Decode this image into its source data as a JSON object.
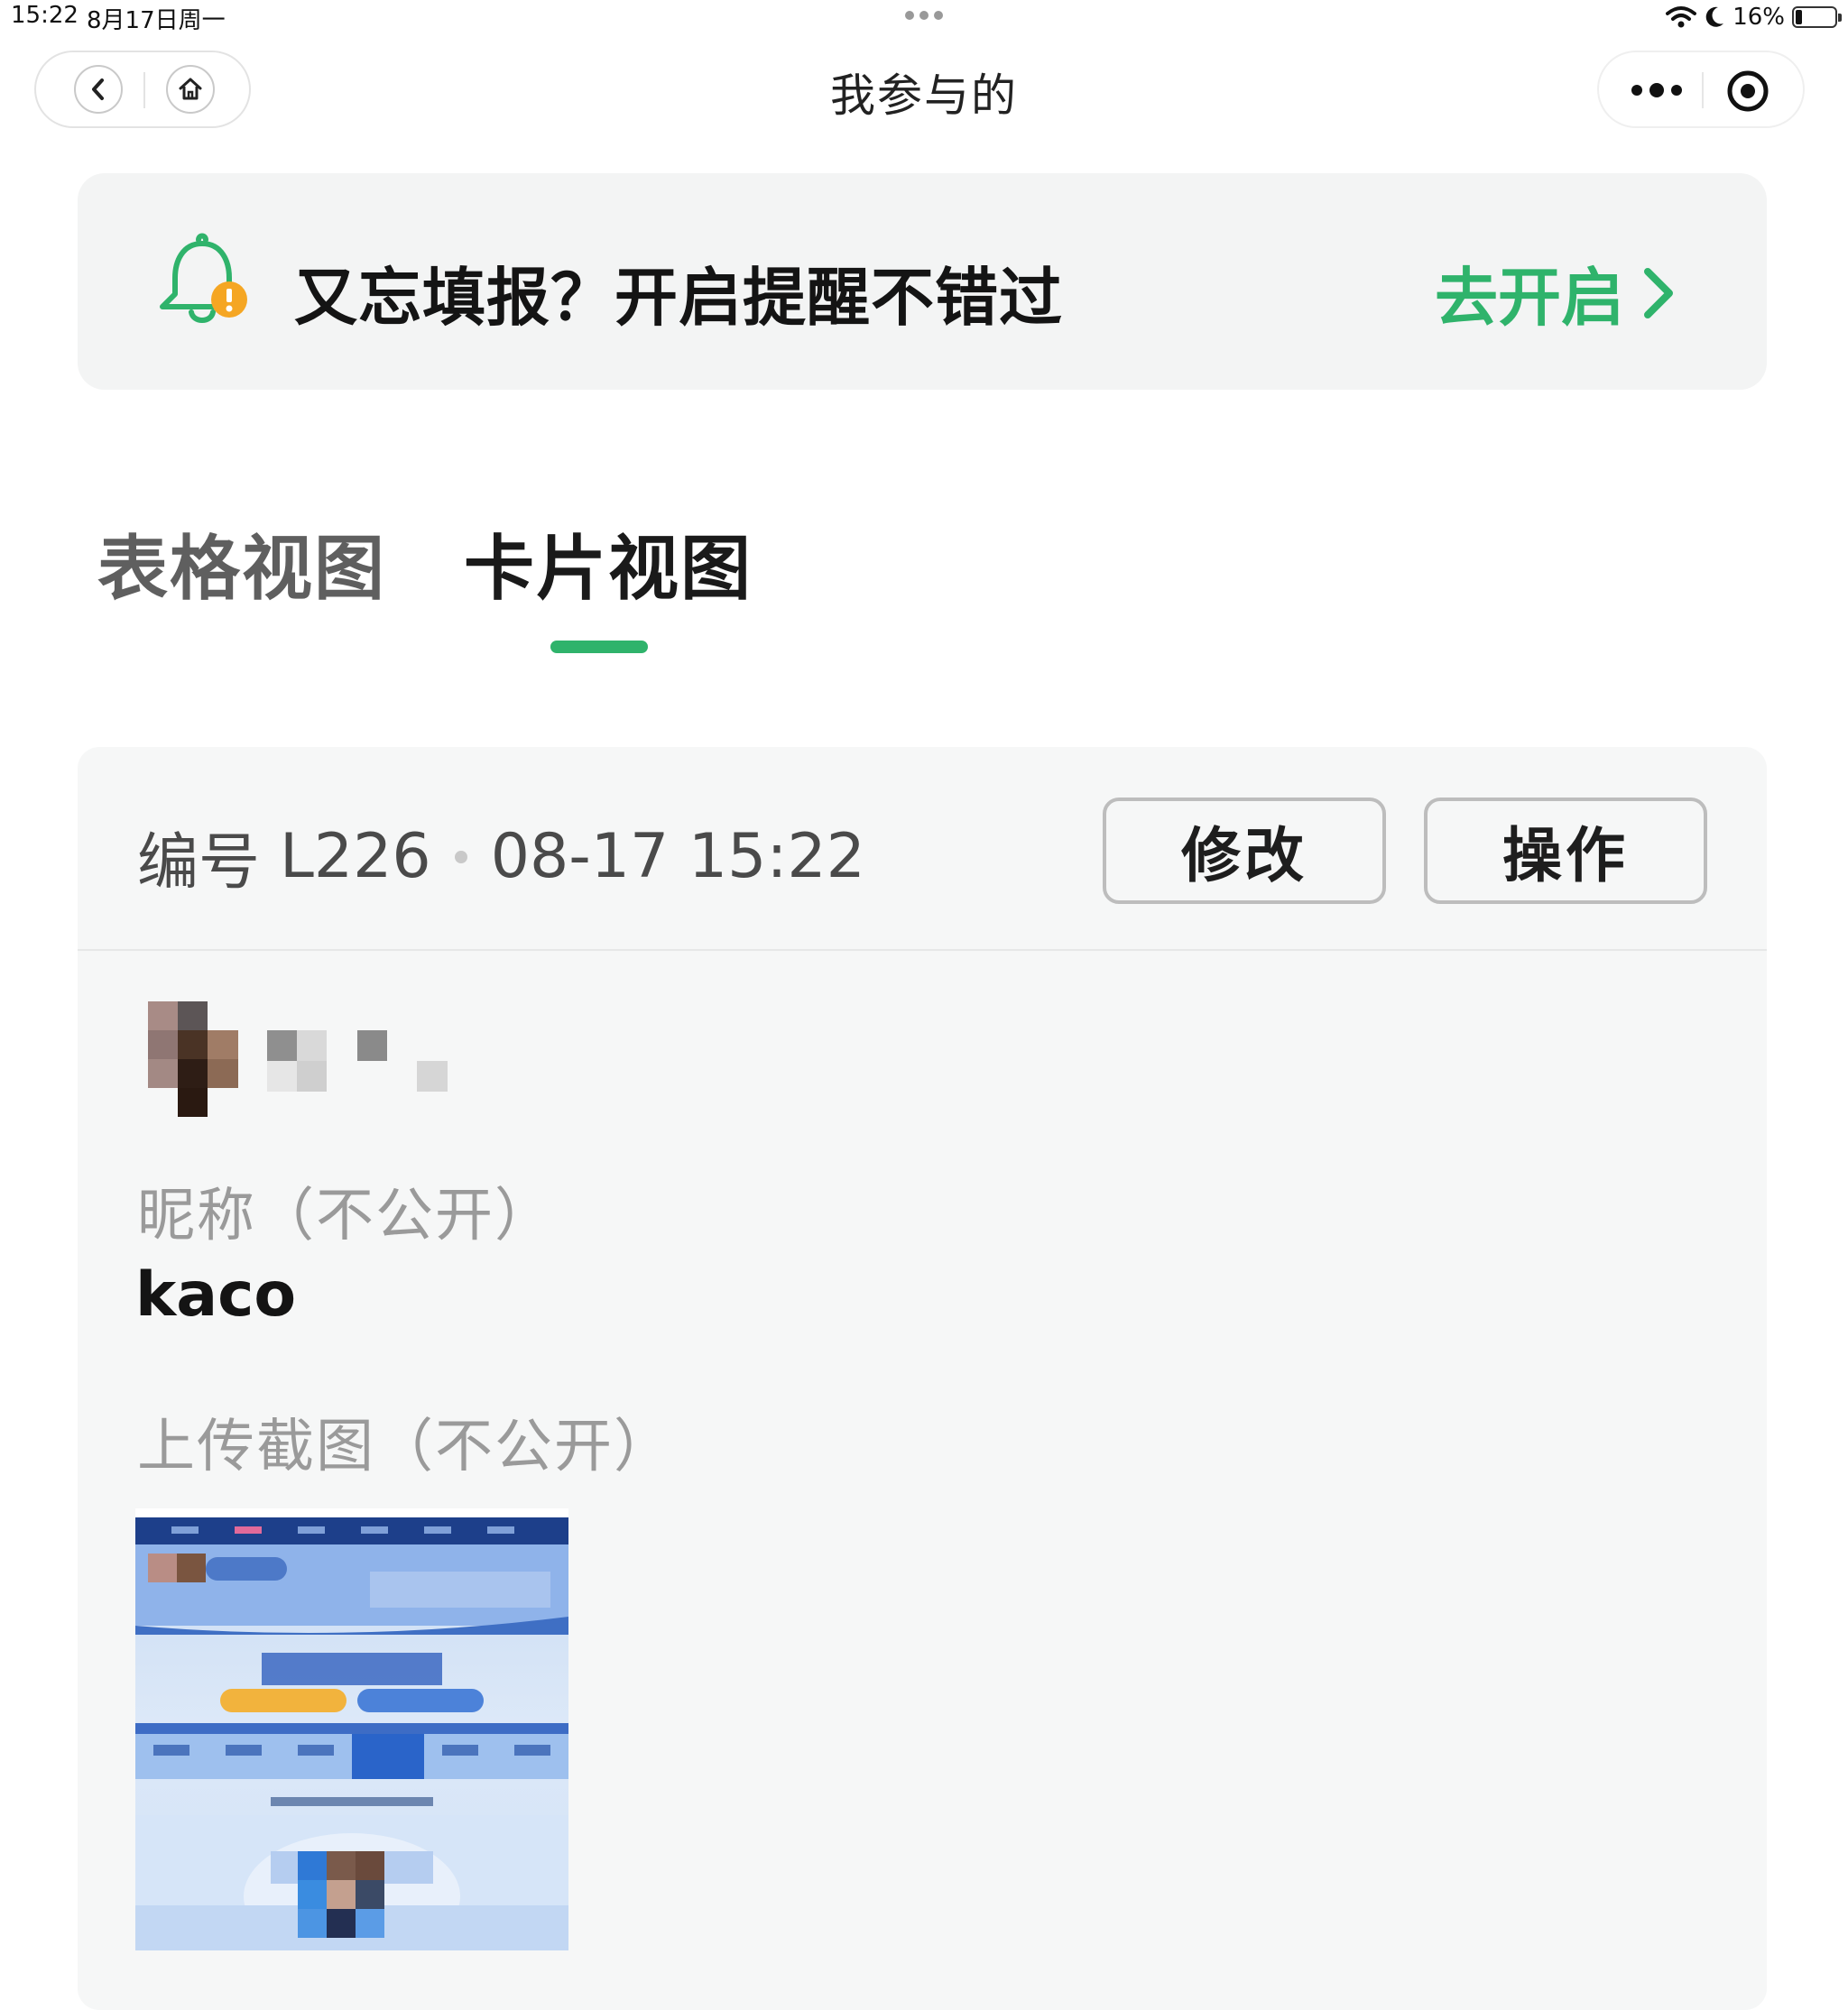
{
  "status_bar": {
    "time": "15:22",
    "date": "8月17日周一",
    "battery": "16%",
    "battery_level": 0.16,
    "icons": [
      "wifi-icon",
      "moon-icon",
      "battery-icon"
    ]
  },
  "nav": {
    "title": "我参与的",
    "back_icon": "chevron-left-icon",
    "home_icon": "home-icon",
    "more_icon": "more-dots-icon",
    "close_icon": "target-circle-icon"
  },
  "reminder": {
    "icon": "bell-alert-icon",
    "text": "又忘填报？开启提醒不错过",
    "link_label": "去开启",
    "link_icon": "chevron-right-icon"
  },
  "tabs": [
    {
      "label": "表格视图",
      "active": false
    },
    {
      "label": "卡片视图",
      "active": true
    }
  ],
  "card": {
    "id_label": "编号",
    "id_value": "L226",
    "timestamp": "08-17 15:22",
    "edit_label": "修改",
    "ops_label": "操作",
    "fields": [
      {
        "label": "昵称（不公开）",
        "value": "kaco"
      },
      {
        "label": "上传截图（不公开）"
      }
    ]
  },
  "colors": {
    "accent": "#2fb36b",
    "alert": "#f5a623",
    "banner_bg": "#f3f4f4",
    "card_bg": "#f6f7f7"
  }
}
